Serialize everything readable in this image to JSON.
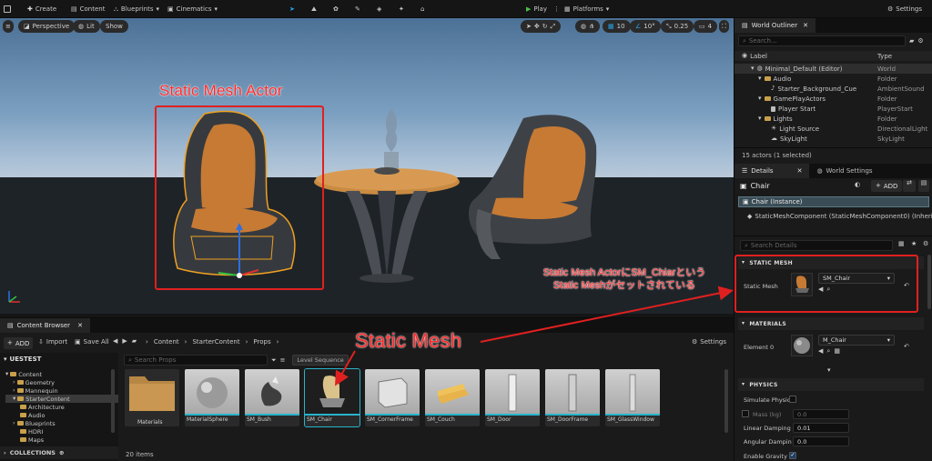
{
  "topbar": {
    "create": "Create",
    "content": "Content",
    "blueprints": "Blueprints",
    "cinematics": "Cinematics",
    "play": "Play",
    "platforms": "Platforms",
    "settings": "Settings"
  },
  "viewport": {
    "perspective": "Perspective",
    "lit": "Lit",
    "show": "Show",
    "grid_snap": "10",
    "rot_snap": "10°",
    "scale_snap": "0.25",
    "cam_speed": "4"
  },
  "annotations": {
    "actor_label": "Static Mesh Actor",
    "mesh_label": "Static Mesh",
    "note_line1": "Static Mesh ActorにSM_Chiarという",
    "note_line2": "Static Meshがセットされている",
    "red": "#e02020"
  },
  "outliner": {
    "tab": "World Outliner",
    "search_placeholder": "Search...",
    "col_label": "Label",
    "col_type": "Type",
    "rows": [
      {
        "label": "Minimal_Default (Editor)",
        "type": "World"
      },
      {
        "label": "Audio",
        "type": "Folder"
      },
      {
        "label": "Starter_Background_Cue",
        "type": "AmbientSound"
      },
      {
        "label": "GamePlayActors",
        "type": "Folder"
      },
      {
        "label": "Player Start",
        "type": "PlayerStart"
      },
      {
        "label": "Lights",
        "type": "Folder"
      },
      {
        "label": "Light Source",
        "type": "DirectionalLight"
      },
      {
        "label": "SkyLight",
        "type": "SkyLight"
      }
    ],
    "status": "15 actors (1 selected)"
  },
  "details": {
    "tab": "Details",
    "tab2": "World Settings",
    "actor_name": "Chair",
    "add": "ADD",
    "instance": "Chair (Instance)",
    "component": "StaticMeshComponent (StaticMeshComponent0) (Inherited)",
    "search_placeholder": "Search Details",
    "section_static_mesh": "STATIC MESH",
    "static_mesh_label": "Static Mesh",
    "static_mesh_value": "SM_Chair",
    "section_materials": "MATERIALS",
    "element_label": "Element 0",
    "material_value": "M_Chair",
    "section_physics": "PHYSICS",
    "simulate_physics": "Simulate Physic",
    "mass_label": "Mass (kg)",
    "mass_value": "0.0",
    "linear_damping_label": "Linear Damping",
    "linear_damping_value": "0.01",
    "angular_damping_label": "Angular Dampin",
    "angular_damping_value": "0.0",
    "enable_gravity": "Enable Gravity"
  },
  "content_browser": {
    "tab": "Content Browser",
    "add": "ADD",
    "import": "Import",
    "save_all": "Save All",
    "path": [
      "Content",
      "StarterContent",
      "Props"
    ],
    "settings": "Settings",
    "project": "UESTEST",
    "search_placeholder": "Search Props",
    "filter_chip": "Level Sequence",
    "tree": [
      "Content",
      "Geometry",
      "Mannequin",
      "StarterContent",
      "Architecture",
      "Audio",
      "Blueprints",
      "HDRI",
      "Maps"
    ],
    "collections": "COLLECTIONS",
    "assets": [
      "Materials",
      "MaterialSphere",
      "SM_Bush",
      "SM_Chair",
      "SM_CornerFrame",
      "SM_Couch",
      "SM_Door",
      "SM_DoorFrame",
      "SM_GlassWindow"
    ],
    "count": "20 items"
  }
}
